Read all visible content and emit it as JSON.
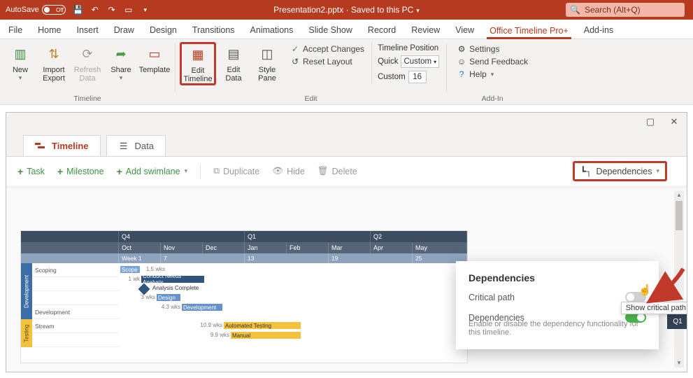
{
  "titlebar": {
    "autosave_label": "AutoSave",
    "autosave_state": "Off",
    "doc_title": "Presentation2.pptx · Saved to this PC",
    "search_placeholder": "Search (Alt+Q)"
  },
  "ribbon_tabs": {
    "file": "File",
    "home": "Home",
    "insert": "Insert",
    "draw": "Draw",
    "design": "Design",
    "transitions": "Transitions",
    "animations": "Animations",
    "slideshow": "Slide Show",
    "record": "Record",
    "review": "Review",
    "view": "View",
    "office_timeline": "Office Timeline Pro+",
    "addins": "Add-ins"
  },
  "ribbon": {
    "groups": {
      "timeline": "Timeline",
      "edit": "Edit",
      "addin": "Add-In"
    },
    "new": "New",
    "import_export": "Import\nExport",
    "refresh": "Refresh\nData",
    "share": "Share",
    "template": "Template",
    "edit_timeline": "Edit\nTimeline",
    "edit_data": "Edit\nData",
    "style_pane": "Style\nPane",
    "accept": "Accept Changes",
    "reset": "Reset Layout",
    "tl_position": "Timeline Position",
    "quick": "Quick",
    "quick_val": "Custom",
    "custom": "Custom",
    "custom_val": "16",
    "settings": "Settings",
    "feedback": "Send Feedback",
    "help": "Help"
  },
  "pane": {
    "tabs": {
      "timeline": "Timeline",
      "data": "Data"
    },
    "toolbar": {
      "task": "Task",
      "milestone": "Milestone",
      "swimlane": "Add swimlane",
      "duplicate": "Duplicate",
      "hide": "Hide",
      "delete": "Delete",
      "dependencies": "Dependencies"
    }
  },
  "popover": {
    "title": "Dependencies",
    "critical_path": "Critical path",
    "deps": "Dependencies",
    "deps_sub": "Enable or disable the dependency functionality for this timeline.",
    "tooltip": "Show critical path"
  },
  "gantt": {
    "quarters": [
      "Q4",
      "Q1",
      "Q2"
    ],
    "months": [
      "Oct",
      "Nov",
      "Dec",
      "Jan",
      "Feb",
      "Mar",
      "Apr",
      "May"
    ],
    "weeks": [
      "Week 1",
      "7",
      "13",
      "19",
      "25"
    ],
    "swim1": "Development",
    "swim2": "Testing",
    "rows": {
      "scoping": "Scoping",
      "blank": "",
      "development": "Development",
      "stream": "Stream"
    },
    "items": {
      "scope": "Scope",
      "scope_dur": "1.5 wks",
      "cna": "Conduct Needs Analysis",
      "cna_dur": "1 wk",
      "ac": "Analysis Complete",
      "design": "Design",
      "design_dur": "3 wks",
      "dev": "Development",
      "dev_dur": "4.3 wks",
      "auto": "Automated Testing",
      "auto_dur": "10.9 wks",
      "manual": "Manual",
      "manual_dur": "9.9 wks"
    },
    "darkbox": "Q1"
  }
}
